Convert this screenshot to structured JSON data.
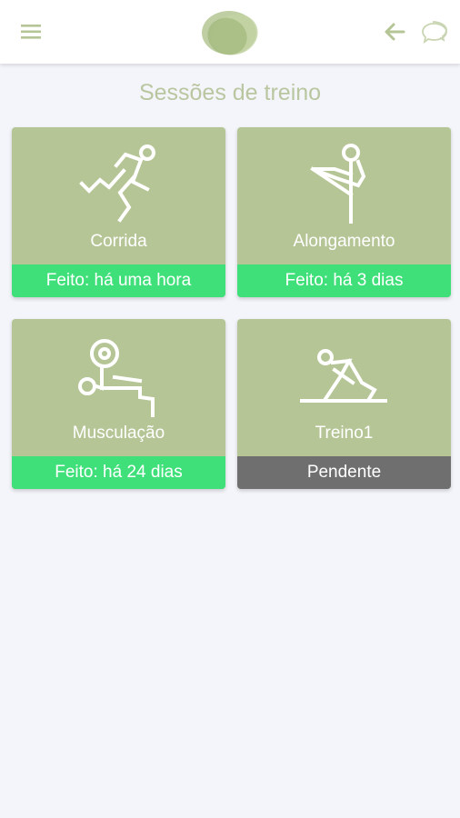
{
  "header": {
    "menu_icon": "hamburger-menu-icon",
    "logo": "leaf-blob-logo",
    "back_icon": "arrow-left-icon",
    "chat_icon": "chat-bubbles-icon"
  },
  "page": {
    "title": "Sessões de treino"
  },
  "sessions": [
    {
      "name": "Corrida",
      "status": "Feito: há uma hora",
      "state": "done",
      "icon": "running-icon"
    },
    {
      "name": "Alongamento",
      "status": "Feito: há 3 dias",
      "state": "done",
      "icon": "stretching-icon"
    },
    {
      "name": "Musculação",
      "status": "Feito: há 24 dias",
      "state": "done",
      "icon": "weightlifting-icon"
    },
    {
      "name": "Treino1",
      "status": "Pendente",
      "state": "pending",
      "icon": "exercise-icon"
    }
  ],
  "colors": {
    "card_bg": "#b5c596",
    "done_status": "#3fe07a",
    "pending_status": "#6f6f6f",
    "title_text": "#b9c6a0",
    "header_icons": "#b5c596",
    "background": "#f4f5fa"
  }
}
